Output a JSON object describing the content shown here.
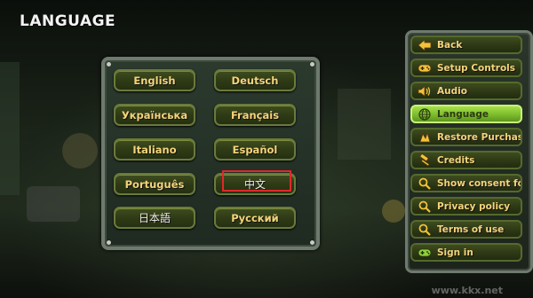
{
  "screen": {
    "title": "LANGUAGE"
  },
  "languages": [
    {
      "label": "English"
    },
    {
      "label": "Deutsch"
    },
    {
      "label": "Українська"
    },
    {
      "label": "Français"
    },
    {
      "label": "Italiano"
    },
    {
      "label": "Español"
    },
    {
      "label": "Português"
    },
    {
      "label": "中文"
    },
    {
      "label": "日本語"
    },
    {
      "label": "Русский"
    }
  ],
  "selected_language": "中文",
  "menu": {
    "items": [
      {
        "label": "Back",
        "icon": "arrow-left-icon"
      },
      {
        "label": "Setup Controls",
        "icon": "gamepad-icon"
      },
      {
        "label": "Audio",
        "icon": "speaker-icon"
      },
      {
        "label": "Language",
        "icon": "globe-icon",
        "active": true
      },
      {
        "label": "Restore Purchases",
        "icon": "restore-icon"
      },
      {
        "label": "Credits",
        "icon": "hammer-icon"
      },
      {
        "label": "Show consent form",
        "icon": "magnifier-icon"
      },
      {
        "label": "Privacy policy",
        "icon": "magnifier-icon"
      },
      {
        "label": "Terms of use",
        "icon": "magnifier-icon"
      },
      {
        "label": "Sign in",
        "icon": "gamepad-icon"
      }
    ]
  },
  "watermark": "www.kkx.net",
  "colors": {
    "button_text": "#f4d47a",
    "active_menu": "#8fd03a",
    "highlight": "#e0282b"
  }
}
